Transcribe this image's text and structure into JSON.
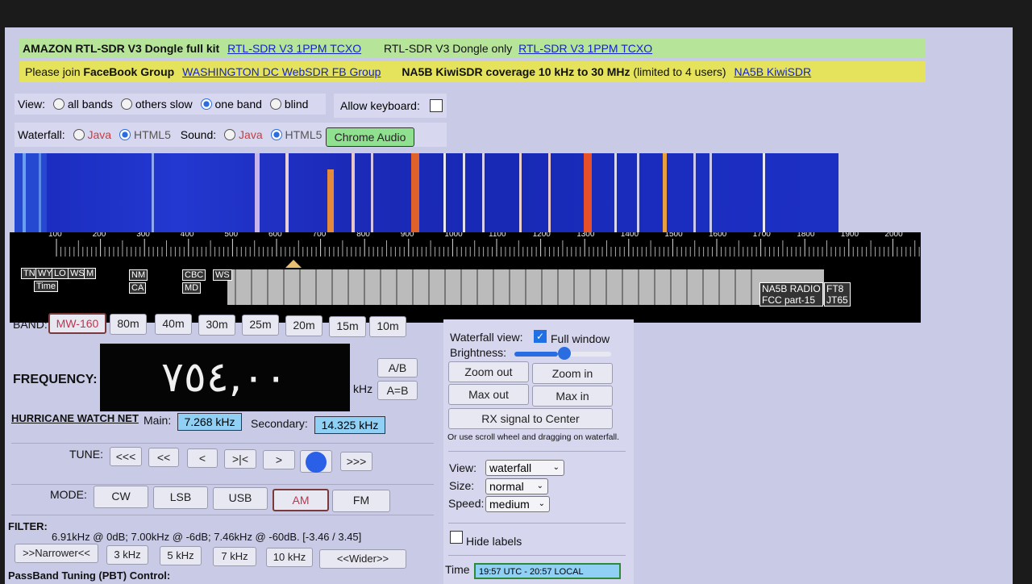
{
  "banner": {
    "amazon_text": "AMAZON RTL-SDR V3 Dongle full kit",
    "amazon_link": "RTL-SDR V3 1PPM TCXO",
    "dongle_text": "RTL-SDR V3 Dongle only",
    "dongle_link": "RTL-SDR V3 1PPM TCXO"
  },
  "join": {
    "prefix": "Please join",
    "fb_group": "FaceBook Group",
    "fb_link": "WASHINGTON DC WebSDR FB Group",
    "kiwi_text": "NA5B KiwiSDR coverage 10 kHz to 30 MHz",
    "kiwi_note": "(limited to 4 users)",
    "kiwi_link": "NA5B KiwiSDR"
  },
  "view": {
    "label": "View:",
    "options": [
      "all bands",
      "others slow",
      "one band",
      "blind"
    ],
    "selected": "one band",
    "allow_keyboard": "Allow keyboard:"
  },
  "waterfall_opts": {
    "label": "Waterfall:",
    "java": "Java",
    "html5": "HTML5",
    "sound_label": "Sound:",
    "sound_java": "Java",
    "sound_html5": "HTML5",
    "chrome_audio": "Chrome Audio"
  },
  "scale": {
    "ticks": [
      "100",
      "200",
      "300",
      "400",
      "500",
      "600",
      "700",
      "800",
      "900",
      "1000",
      "1100",
      "1200",
      "1300",
      "1400",
      "1500",
      "1600",
      "1700",
      "1800",
      "1900",
      "2000"
    ],
    "labels_left": [
      "TN",
      "WY",
      "LO",
      "WS",
      "M",
      "NM",
      "CA",
      "CBC",
      "MD",
      "WS"
    ],
    "time_label": "Time",
    "labels_right": [
      "NA5B RADIO",
      "FCC part-15",
      "FT8",
      "JT65"
    ]
  },
  "band": {
    "label": "BAND:",
    "items": [
      "MW-160",
      "80m",
      "40m",
      "30m",
      "25m",
      "20m",
      "15m",
      "10m"
    ],
    "selected": "MW-160"
  },
  "frequency": {
    "label": "FREQUENCY:",
    "display": "٧٥٤,٠٠",
    "unit": "kHz",
    "ab": "A/B",
    "a_eq_b": "A=B"
  },
  "net": {
    "name": "HURRICANE WATCH NET",
    "main_label": "Main:",
    "main_value": "7.268 kHz",
    "secondary_label": "Secondary:",
    "secondary_value": "14.325 kHz"
  },
  "tune": {
    "label": "TUNE:",
    "buttons": [
      "<<<",
      "<<",
      "<",
      ">|<",
      ">",
      ">>>"
    ]
  },
  "mode": {
    "label": "MODE:",
    "items": [
      "CW",
      "LSB",
      "USB",
      "AM",
      "FM"
    ],
    "selected": "AM"
  },
  "filter": {
    "label": "FILTER:",
    "text": "6.91kHz @ 0dB; 7.00kHz @ -6dB; 7.46kHz @ -60dB. [-3.46 / 3.45]",
    "buttons": [
      ">>Narrower<<",
      "3 kHz",
      "5 kHz",
      "7 kHz",
      "10 kHz",
      "<<Wider>>"
    ]
  },
  "pbt": {
    "label": "PassBand Tuning (PBT) Control:"
  },
  "wfview": {
    "label": "Waterfall view:",
    "full_window": "Full window",
    "brightness": "Brightness:",
    "brightness_level": 0.45,
    "zoom_out": "Zoom out",
    "zoom_in": "Zoom in",
    "max_out": "Max out",
    "max_in": "Max in",
    "rx_center": "RX signal to Center",
    "hint": "Or use scroll wheel and dragging on waterfall."
  },
  "display_opts": {
    "view_label": "View:",
    "view_value": "waterfall",
    "size_label": "Size:",
    "size_value": "normal",
    "speed_label": "Speed:",
    "speed_value": "medium",
    "hide_labels": "Hide labels"
  },
  "time": {
    "label": "Time",
    "value": "19:57 UTC - 20:57 LOCAL"
  }
}
